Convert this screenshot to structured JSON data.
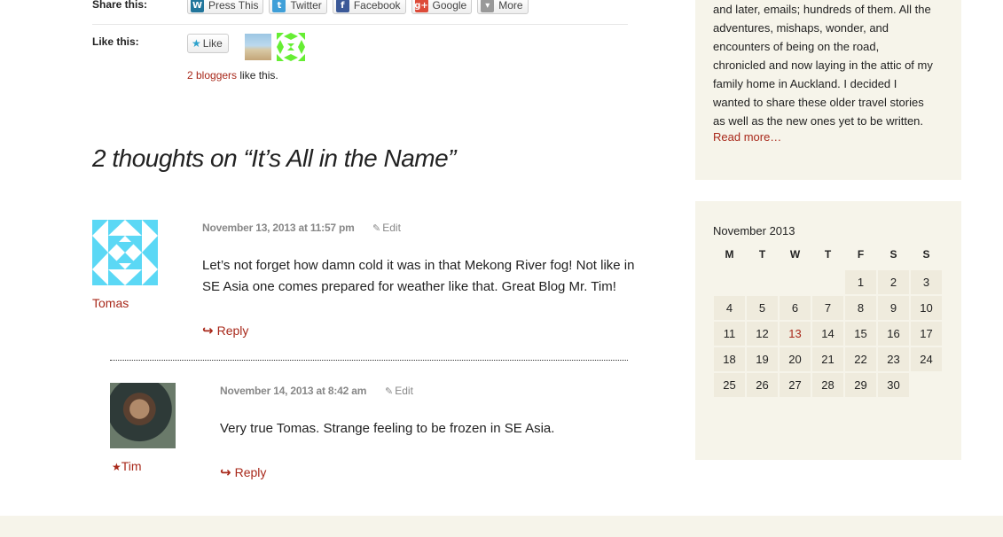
{
  "share": {
    "label": "Share this:",
    "buttons": [
      {
        "label": "Press This",
        "icon": "wordpress-icon",
        "color": "#21759b"
      },
      {
        "label": "Twitter",
        "icon": "twitter-icon",
        "color": "#3f9fd8"
      },
      {
        "label": "Facebook",
        "icon": "facebook-icon",
        "color": "#3b5998"
      },
      {
        "label": "Google",
        "icon": "google-plus-icon",
        "color": "#dd4b39"
      },
      {
        "label": "More",
        "icon": "dropdown-icon",
        "color": "#888888"
      }
    ]
  },
  "like": {
    "label": "Like this:",
    "button_label": "Like",
    "bloggers_link": "2 bloggers",
    "bloggers_suffix": " like this."
  },
  "comments": {
    "title": "2 thoughts on “It’s All in the Name”",
    "items": [
      {
        "author": "Tomas",
        "date": "November 13, 2013 at 11:57 pm",
        "edit": "Edit",
        "text": "Let’s not forget how damn cold it was in that Mekong River fog! Not like in SE Asia one comes prepared for weather like that. Great Blog Mr. Tim!",
        "reply": "Reply"
      },
      {
        "author": "Tim",
        "date": "November 14, 2013 at 8:42 am",
        "edit": "Edit",
        "text": "Very true Tomas. Strange feeling to be frozen in SE Asia.",
        "reply": "Reply"
      }
    ]
  },
  "sidebar": {
    "about_lines": [
      "and later, emails; hundreds of them. All the",
      "adventures, mishaps, wonder, and",
      "encounters of being on the road,",
      "chronicled and now laying in the attic of my",
      "family home in Auckland. I decided I",
      "wanted to share these older travel stories",
      "as well as the new ones yet to be written."
    ],
    "read_more": "Read more…",
    "calendar": {
      "caption": "November 2013",
      "days": [
        "M",
        "T",
        "W",
        "T",
        "F",
        "S",
        "S"
      ],
      "weeks": [
        [
          "",
          "",
          "",
          "",
          "1",
          "2",
          "3"
        ],
        [
          "4",
          "5",
          "6",
          "7",
          "8",
          "9",
          "10"
        ],
        [
          "11",
          "12",
          "13",
          "14",
          "15",
          "16",
          "17"
        ],
        [
          "18",
          "19",
          "20",
          "21",
          "22",
          "23",
          "24"
        ],
        [
          "25",
          "26",
          "27",
          "28",
          "29",
          "30",
          ""
        ]
      ],
      "highlighted_day": "13"
    }
  },
  "colors": {
    "accent": "#a8281a",
    "sidebar_bg": "#f6f4ea",
    "identicon": "#5bd8f5",
    "identicon2": "#66ee33"
  }
}
